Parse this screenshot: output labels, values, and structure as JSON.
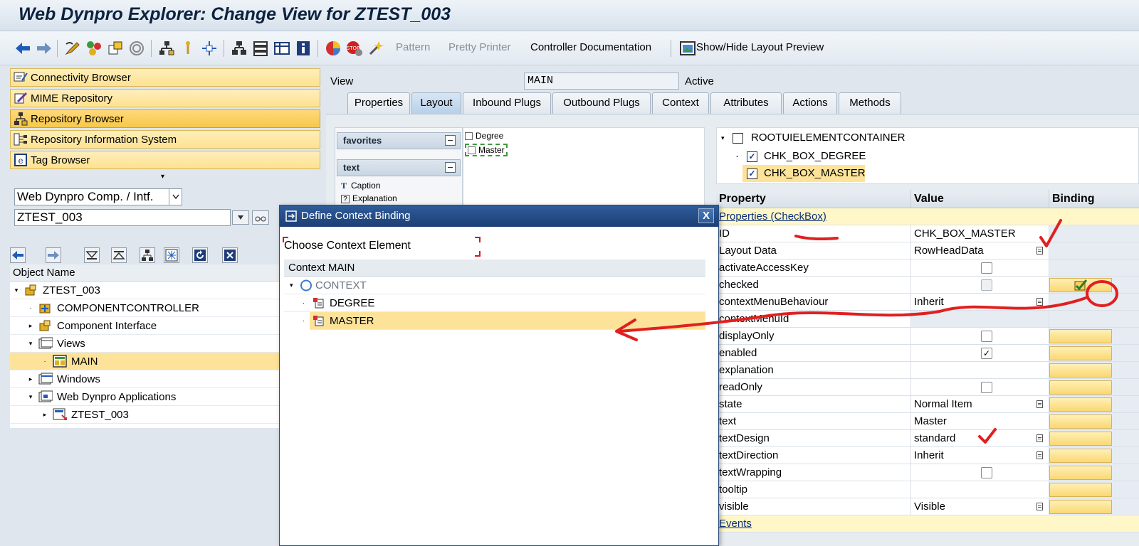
{
  "window": {
    "title": "Web Dynpro Explorer: Change View for ZTEST_003"
  },
  "toolbar": {
    "pattern_label": "Pattern",
    "pretty_printer_label": "Pretty Printer",
    "controller_doc_label": "Controller Documentation",
    "layout_preview_label": "Show/Hide Layout Preview"
  },
  "left_nav": {
    "items": [
      {
        "label": "Connectivity Browser",
        "icon": "connectivity-icon"
      },
      {
        "label": "MIME Repository",
        "icon": "mime-icon"
      },
      {
        "label": "Repository Browser",
        "icon": "repository-browser-icon",
        "active": true
      },
      {
        "label": "Repository Information System",
        "icon": "repo-info-icon"
      },
      {
        "label": "Tag Browser",
        "icon": "tag-browser-icon"
      }
    ],
    "object_type": "Web Dynpro Comp. / Intf.",
    "object_name": "ZTEST_003"
  },
  "object_tree": {
    "header": "Object Name",
    "rows": [
      {
        "label": "ZTEST_003",
        "level": 0,
        "expand": "▾"
      },
      {
        "label": "COMPONENTCONTROLLER",
        "level": 1,
        "expand": "·"
      },
      {
        "label": "Component Interface",
        "level": 1,
        "expand": "▸"
      },
      {
        "label": "Views",
        "level": 1,
        "expand": "▾"
      },
      {
        "label": "MAIN",
        "level": 2,
        "expand": "·",
        "selected": true
      },
      {
        "label": "Windows",
        "level": 1,
        "expand": "▸"
      },
      {
        "label": "Web Dynpro Applications",
        "level": 1,
        "expand": "▾"
      },
      {
        "label": "ZTEST_003",
        "level": 2,
        "expand": "▸"
      }
    ]
  },
  "view_header": {
    "label": "View",
    "name": "MAIN",
    "status": "Active"
  },
  "tabs": [
    {
      "label": "Properties"
    },
    {
      "label": "Layout",
      "active": true
    },
    {
      "label": "Inbound Plugs"
    },
    {
      "label": "Outbound Plugs"
    },
    {
      "label": "Context"
    },
    {
      "label": "Attributes"
    },
    {
      "label": "Actions"
    },
    {
      "label": "Methods"
    }
  ],
  "palette": {
    "favorites_label": "favorites",
    "text_label": "text",
    "items": [
      "Caption",
      "Explanation"
    ]
  },
  "preview": {
    "items": [
      "Degree",
      "Master"
    ]
  },
  "ui_tree": {
    "root": "ROOTUIELEMENTCONTAINER",
    "children": [
      {
        "label": "CHK_BOX_DEGREE",
        "checked": true
      },
      {
        "label": "CHK_BOX_MASTER",
        "checked": true,
        "selected": true
      }
    ]
  },
  "property_table": {
    "headers": {
      "property": "Property",
      "value": "Value",
      "binding": "Binding"
    },
    "section": "Properties (CheckBox)",
    "rows": [
      {
        "property": "ID",
        "value": "CHK_BOX_MASTER"
      },
      {
        "property": "Layout Data",
        "value": "RowHeadData"
      },
      {
        "property": "activateAccessKey",
        "value": ""
      },
      {
        "property": "checked",
        "value": ""
      },
      {
        "property": "contextMenuBehaviour",
        "value": "Inherit"
      },
      {
        "property": "contextMenuId",
        "value": ""
      },
      {
        "property": "displayOnly",
        "value": ""
      },
      {
        "property": "enabled",
        "value": ""
      },
      {
        "property": "explanation",
        "value": ""
      },
      {
        "property": "readOnly",
        "value": ""
      },
      {
        "property": "state",
        "value": "Normal Item"
      },
      {
        "property": "text",
        "value": "Master"
      },
      {
        "property": "textDesign",
        "value": "standard"
      },
      {
        "property": "textDirection",
        "value": "Inherit"
      },
      {
        "property": "textWrapping",
        "value": ""
      },
      {
        "property": "tooltip",
        "value": ""
      },
      {
        "property": "visible",
        "value": "Visible"
      }
    ],
    "events_section": "Events"
  },
  "dialog": {
    "title": "Define Context Binding",
    "close_label": "X",
    "instruction": "Choose Context Element",
    "tree_header": "Context MAIN",
    "rows": [
      {
        "label": "CONTEXT",
        "expand": "▾"
      },
      {
        "label": "DEGREE",
        "expand": "·"
      },
      {
        "label": "MASTER",
        "expand": "·",
        "selected": true
      }
    ]
  },
  "colors": {
    "nav_button": "#fde290",
    "selection": "#fde39a",
    "dialog_title": "#1c3f74",
    "annotation_red": "#e02020"
  }
}
